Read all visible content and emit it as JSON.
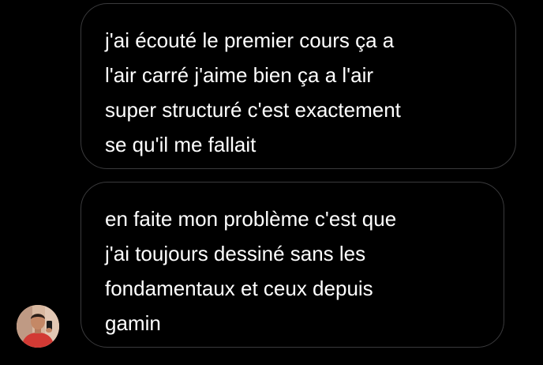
{
  "messages": [
    {
      "lines": [
        "j'ai écouté le premier cours ça a",
        "l'air carré j'aime bien ça a l'air",
        "super structuré c'est exactement",
        "se qu'il me fallait"
      ]
    },
    {
      "lines": [
        "en faite mon problème c'est que",
        "j'ai toujours dessiné sans les",
        "fondamentaux et ceux depuis",
        "gamin"
      ]
    }
  ],
  "colors": {
    "background": "#000000",
    "bubble_border": "#3a3a3c",
    "text": "#ffffff"
  },
  "icons": {
    "avatar": "user-avatar-photo"
  }
}
